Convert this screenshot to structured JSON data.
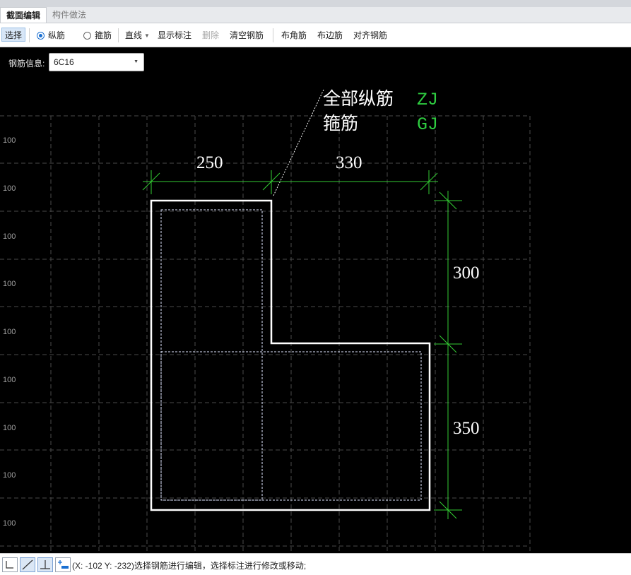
{
  "tabs": [
    {
      "label": "截面编辑",
      "active": true
    },
    {
      "label": "构件做法",
      "active": false
    }
  ],
  "toolbar": {
    "select": "选择",
    "longitudinal": "纵筋",
    "stirrup": "箍筋",
    "line": "直线",
    "show_dims": "显示标注",
    "delete": "删除",
    "clear_rebar": "清空钢筋",
    "corner_rebar": "布角筋",
    "edge_rebar": "布边筋",
    "align_rebar": "对齐钢筋"
  },
  "rebar_info": {
    "label": "钢筋信息:",
    "value": "6C16"
  },
  "legend": [
    {
      "label": "全部纵筋",
      "code": "ZJ"
    },
    {
      "label": "箍筋",
      "code": "GJ"
    }
  ],
  "dimensions": {
    "top_left": "250",
    "top_right": "330",
    "right_upper": "300",
    "right_lower": "350"
  },
  "grid_labels": [
    "100",
    "100",
    "100",
    "100",
    "100",
    "100",
    "100",
    "100",
    "100"
  ],
  "colors": {
    "dim_green": "#33cc33",
    "legend_code": "#2ecc40",
    "outline": "#ffffff",
    "grid": "#555555"
  },
  "status": {
    "text": "(X: -102 Y: -232)选择钢筋进行编辑，选择标注进行修改或移动;"
  }
}
